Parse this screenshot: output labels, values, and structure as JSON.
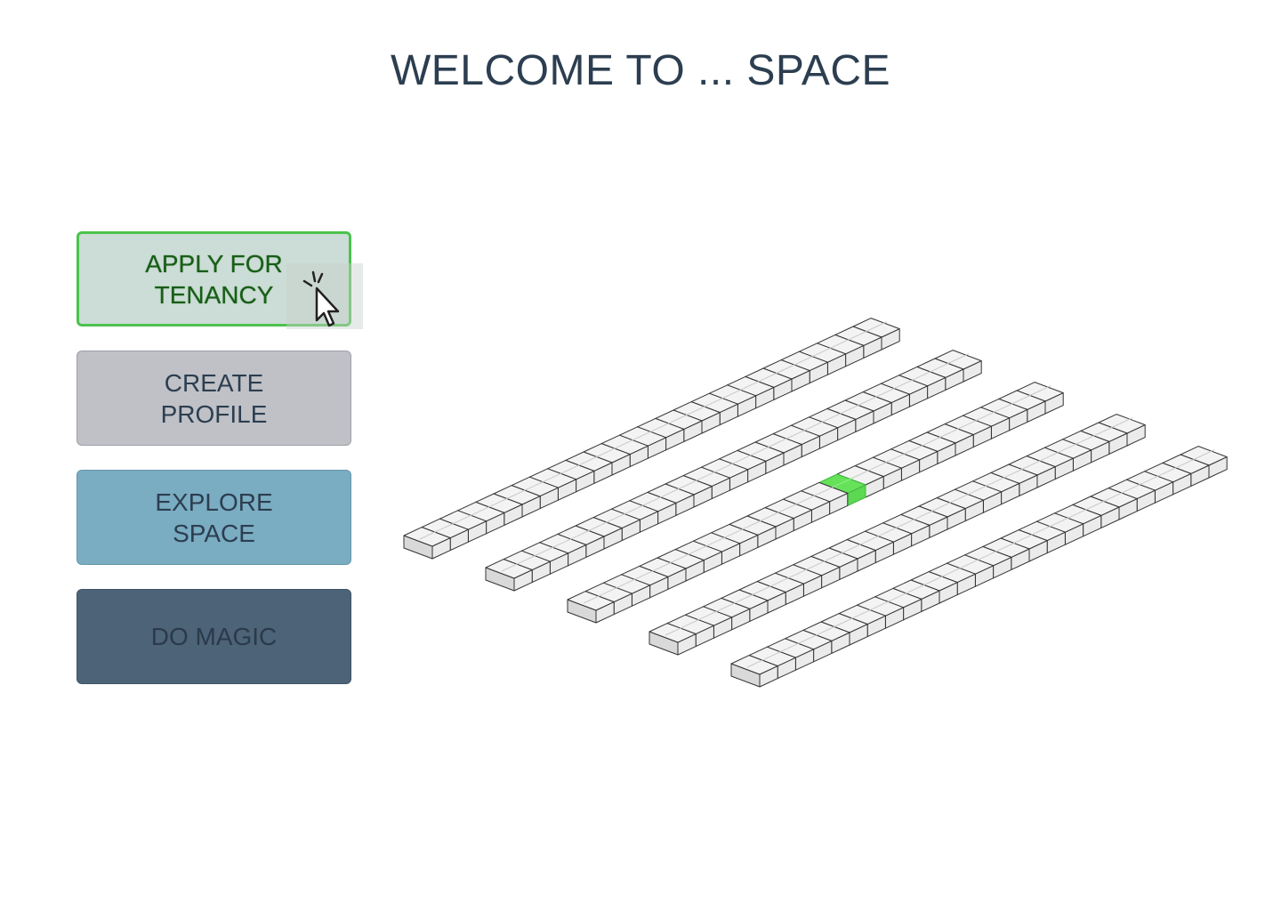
{
  "page": {
    "title": "WELCOME TO ... SPACE"
  },
  "menu": {
    "buttons": [
      {
        "id": "apply",
        "label": "APPLY FOR\nTENANCY",
        "state": "hover"
      },
      {
        "id": "profile",
        "label": "CREATE\nPROFILE",
        "state": "default"
      },
      {
        "id": "explore",
        "label": "EXPLORE\nSPACE",
        "state": "default"
      },
      {
        "id": "magic",
        "label": "DO MAGIC",
        "state": "default"
      }
    ]
  },
  "cursor": {
    "icon": "click-pointer-icon"
  },
  "building": {
    "rows": 5,
    "units_per_row": 26,
    "highlighted_unit": {
      "row": 3,
      "unit": 15
    },
    "colors": {
      "unit_top": "#f3f3f3",
      "unit_side": "#d9d9d9",
      "unit_stroke": "#333333",
      "highlight": "#66e25a",
      "highlight_stroke": "#3fb83a"
    }
  },
  "colors": {
    "title": "#2c3e50",
    "apply_border": "#4cc24c",
    "apply_bg": "#ccdcd6",
    "profile_bg": "#bfc1c6",
    "explore_bg": "#7aacc2",
    "magic_bg": "#4d6378"
  }
}
